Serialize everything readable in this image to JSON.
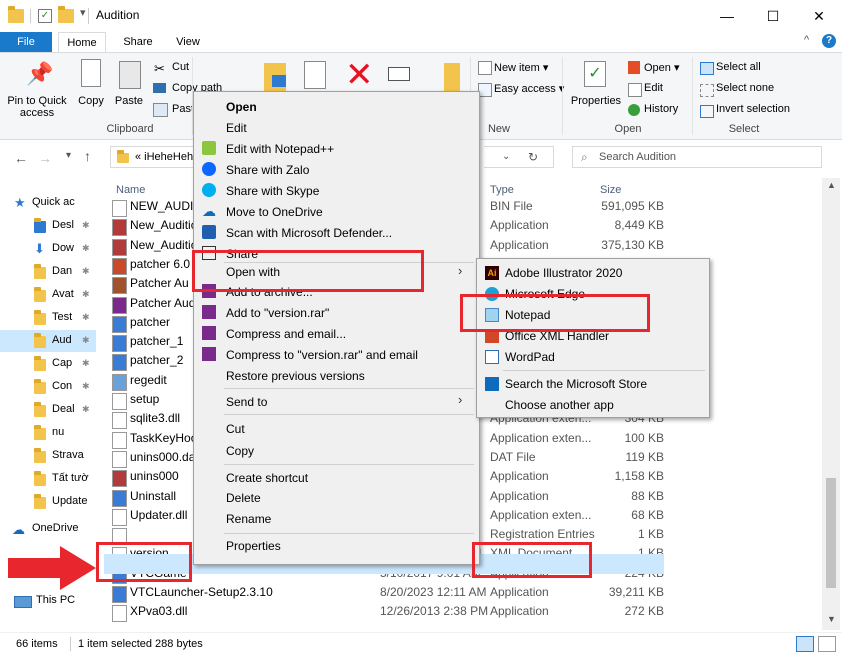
{
  "window": {
    "title": "Audition",
    "minimize": "—",
    "maximize": "☐",
    "close": "✕"
  },
  "tabs": {
    "file": "File",
    "home": "Home",
    "share": "Share",
    "view": "View"
  },
  "ribbon": {
    "pin_quick_access": "Pin to Quick access",
    "copy": "Copy",
    "paste": "Paste",
    "cut": "Cut",
    "copy_path": "Copy path",
    "paste_shortcut": "Paste",
    "clipboard_group": "Clipboard",
    "new_item": "New item ▾",
    "easy_access": "Easy access ▾",
    "new_group": "New",
    "properties": "Properties",
    "open": "Open ▾",
    "edit": "Edit",
    "history": "History",
    "open_group": "Open",
    "select_all": "Select all",
    "select_none": "Select none",
    "invert_selection": "Invert selection",
    "select_group": "Select"
  },
  "address": {
    "path": "« iHeheHehe",
    "search_placeholder": "Search Audition"
  },
  "columns": {
    "name": "Name",
    "type": "Type",
    "size": "Size"
  },
  "nav": [
    {
      "label": "Quick ac"
    },
    {
      "label": "Desl"
    },
    {
      "label": "Dow"
    },
    {
      "label": "Dan"
    },
    {
      "label": "Avat"
    },
    {
      "label": "Test"
    },
    {
      "label": "Aud"
    },
    {
      "label": "Cap"
    },
    {
      "label": "Con"
    },
    {
      "label": "Deal"
    },
    {
      "label": "nu"
    },
    {
      "label": "Strava"
    },
    {
      "label": "Tất tườ"
    },
    {
      "label": "Update"
    },
    {
      "label": "OneDrive"
    },
    {
      "label": "This PC"
    }
  ],
  "files": [
    {
      "name": "NEW_AUDITI",
      "type": "BIN File",
      "size": "591,095 KB"
    },
    {
      "name": "New_Auditio",
      "type": "Application",
      "size": "8,449 KB"
    },
    {
      "name": "New_Auditio",
      "type": "Application",
      "size": "375,130 KB"
    },
    {
      "name": "patcher 6.0"
    },
    {
      "name": "Patcher Au"
    },
    {
      "name": "Patcher Audi"
    },
    {
      "name": "patcher"
    },
    {
      "name": "patcher_1"
    },
    {
      "name": "patcher_2"
    },
    {
      "name": "regedit"
    },
    {
      "name": "setup"
    },
    {
      "name": "sqlite3.dll",
      "type": "Application exten...",
      "size": "304 KB"
    },
    {
      "name": "TaskKeyHook",
      "type": "Application exten...",
      "size": "100 KB"
    },
    {
      "name": "unins000.dat",
      "type": "DAT File",
      "size": "119 KB"
    },
    {
      "name": "unins000",
      "type": "Application",
      "size": "1,158 KB"
    },
    {
      "name": "Uninstall",
      "type": "Application",
      "size": "88 KB"
    },
    {
      "name": "Updater.dll",
      "type": "Application exten...",
      "size": "68 KB"
    },
    {
      "name": "",
      "type": "Registration Entries",
      "size": "1 KB"
    },
    {
      "name": "version",
      "date": "3/19/2025 1:52 PM",
      "type": "XML Document",
      "size": "1 KB"
    },
    {
      "name": "VTCGame",
      "date": "5/10/2017 9:01 AM",
      "type": "Application",
      "size": "224 KB"
    },
    {
      "name": "VTCLauncher-Setup2.3.10",
      "date": "8/20/2023 12:11 AM",
      "type": "Application",
      "size": "39,211 KB"
    },
    {
      "name": "XPva03.dll",
      "date": "12/26/2013 2:38 PM",
      "type": "Application",
      "size": "272 KB"
    }
  ],
  "context_menu": {
    "open": "Open",
    "edit": "Edit",
    "edit_notepadpp": "Edit with Notepad++",
    "share_zalo": "Share with Zalo",
    "share_skype": "Share with Skype",
    "move_onedrive": "Move to OneDrive",
    "scan_defender": "Scan with Microsoft Defender...",
    "share": "Share",
    "open_with": "Open with",
    "add_archive": "Add to archive...",
    "add_version_rar": "Add to \"version.rar\"",
    "compress_email": "Compress and email...",
    "compress_version_email": "Compress to \"version.rar\" and email",
    "restore_versions": "Restore previous versions",
    "send_to": "Send to",
    "cut": "Cut",
    "copy": "Copy",
    "create_shortcut": "Create shortcut",
    "delete": "Delete",
    "rename": "Rename",
    "properties": "Properties"
  },
  "open_with_menu": {
    "illustrator": "Adobe Illustrator 2020",
    "edge": "Microsoft Edge",
    "notepad": "Notepad",
    "office_xml": "Office XML Handler",
    "wordpad": "WordPad",
    "search_store": "Search the Microsoft Store",
    "choose_another": "Choose another app"
  },
  "status": {
    "items": "66 items",
    "selected": "1 item selected  288 bytes"
  },
  "colors": {
    "accent": "#1979ca",
    "highlight": "#e8262d",
    "selection": "#cce8ff"
  }
}
